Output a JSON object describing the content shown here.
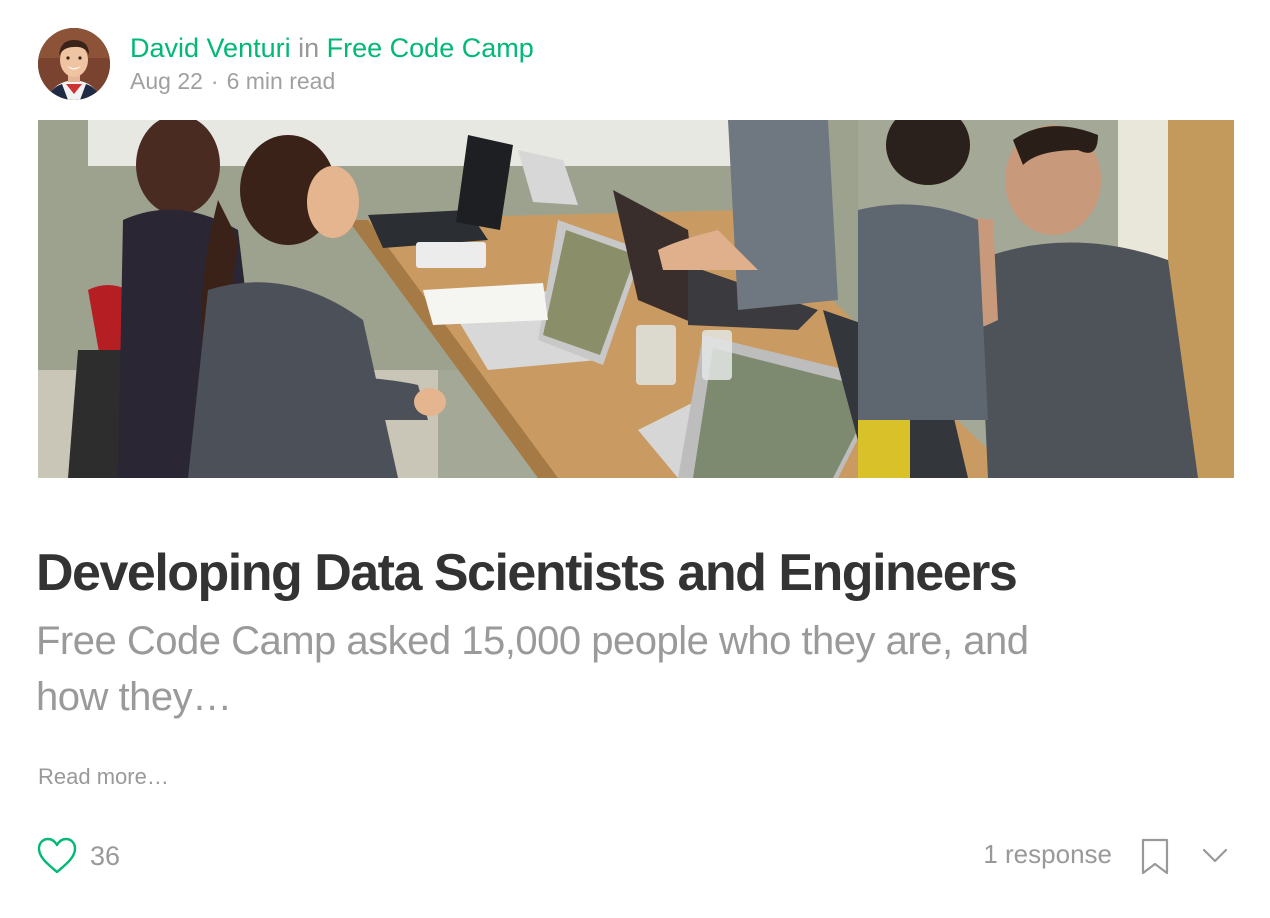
{
  "post": {
    "author": "David Venturi",
    "in_word": "in",
    "publication": "Free Code Camp",
    "date": "Aug 22",
    "separator": "·",
    "read_time": "6 min read",
    "title": "Developing Data Scientists and Engineers",
    "subtitle": "Free Code Camp asked 15,000 people who they are, and how they…",
    "read_more": "Read more…"
  },
  "footer": {
    "likes": "36",
    "responses": "1 response"
  },
  "icons": {
    "heart": "heart-icon",
    "bookmark": "bookmark-icon",
    "more": "chevron-down-icon"
  },
  "colors": {
    "accent": "#02b875",
    "title": "#333333",
    "muted": "#999999"
  }
}
